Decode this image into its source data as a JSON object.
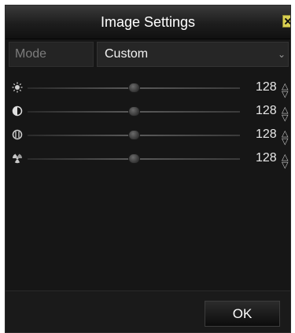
{
  "dialog": {
    "title": "Image Settings"
  },
  "mode": {
    "label": "Mode",
    "value": "Custom"
  },
  "params": [
    {
      "icon": "brightness-icon",
      "value": "128",
      "level": 0.5
    },
    {
      "icon": "contrast-icon",
      "value": "128",
      "level": 0.5
    },
    {
      "icon": "saturation-icon",
      "value": "128",
      "level": 0.5
    },
    {
      "icon": "hue-icon",
      "value": "128",
      "level": 0.5
    }
  ],
  "footer": {
    "ok_label": "OK"
  },
  "colors": {
    "panel_bg": "#161616",
    "titlebar": "#1d1d1d",
    "text": "#ffffff",
    "close_button": "#d8cf52"
  }
}
